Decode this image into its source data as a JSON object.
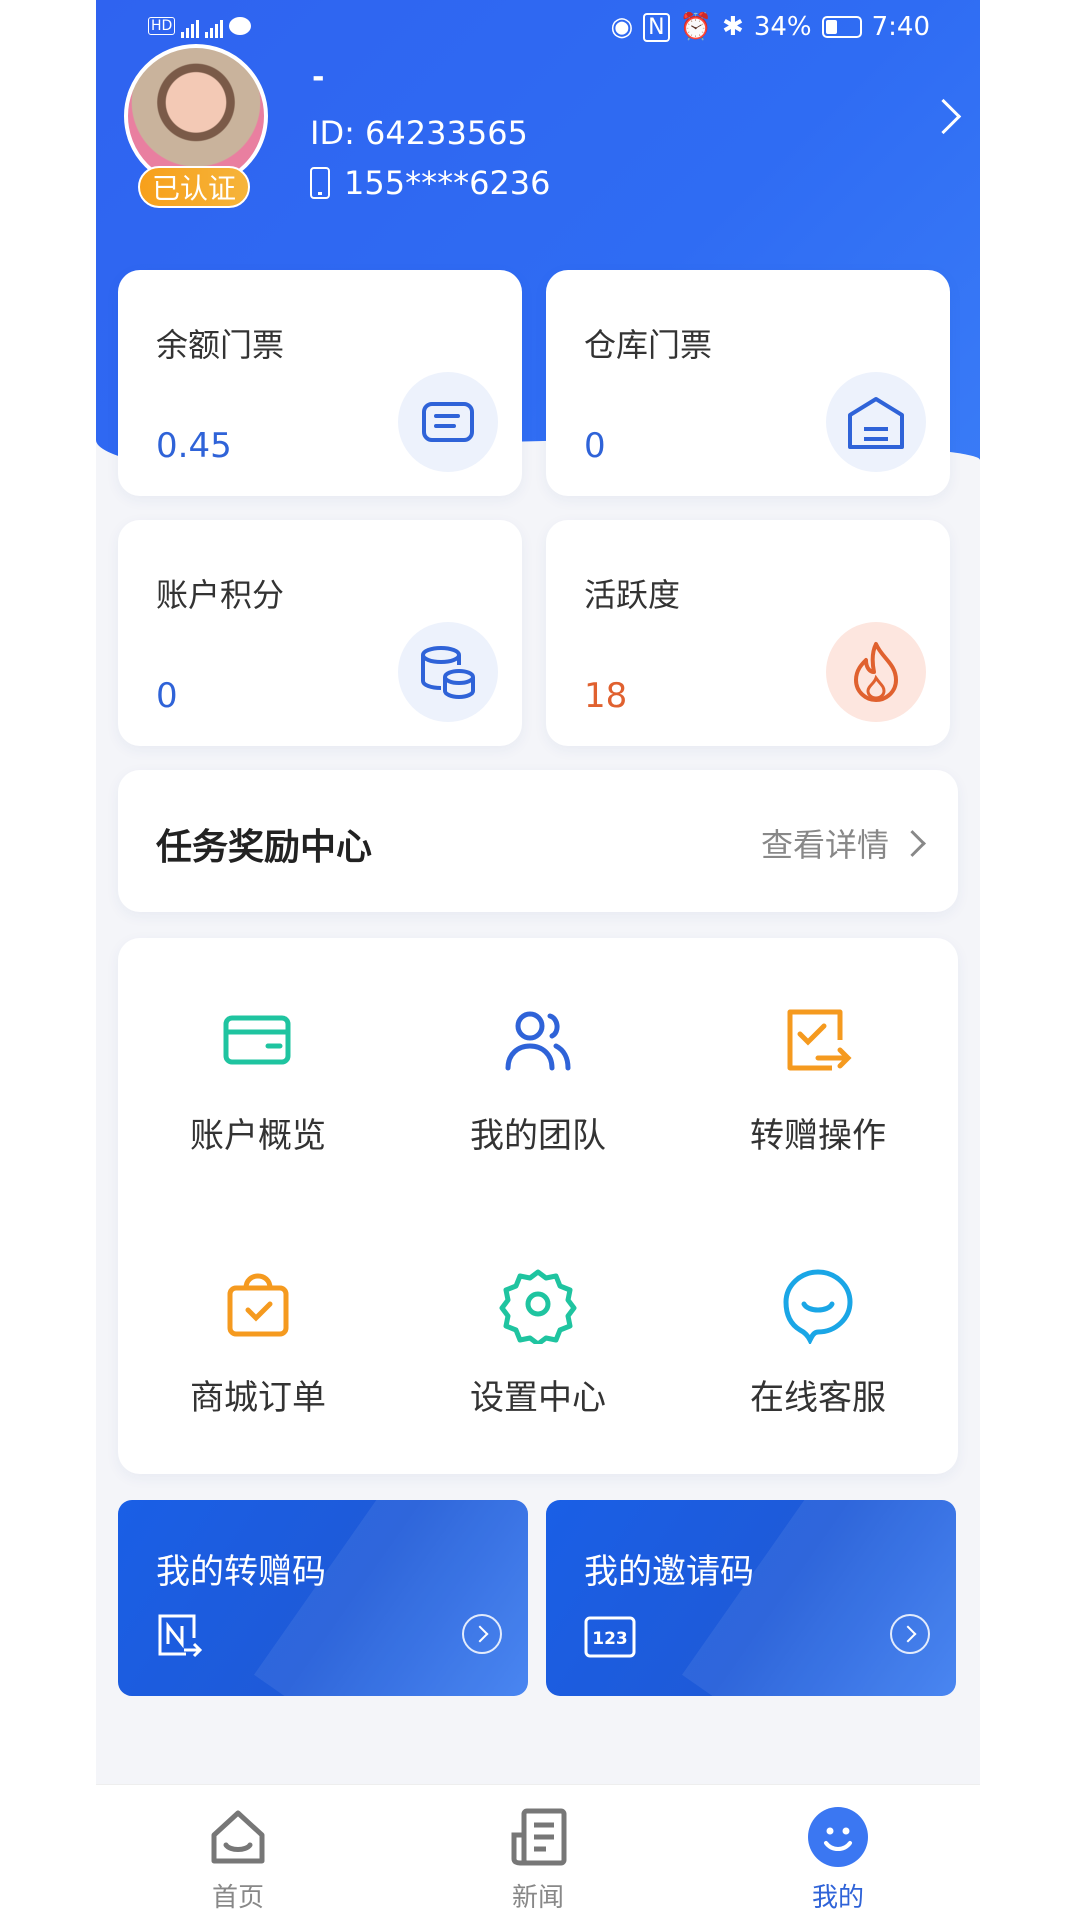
{
  "status_bar": {
    "left_indicators": "HD 1 4G 4G",
    "battery": "34%",
    "battery_level": 0.34,
    "time": "7:40"
  },
  "profile": {
    "nickname": "-",
    "id_text": "ID:  64233565",
    "phone": "155****6236",
    "verified_badge": "已认证"
  },
  "stats": [
    {
      "label": "余额门票",
      "value": "0.45",
      "icon": "ticket-icon"
    },
    {
      "label": "仓库门票",
      "value": "0",
      "icon": "warehouse-icon"
    },
    {
      "label": "账户积分",
      "value": "0",
      "icon": "coins-icon"
    },
    {
      "label": "活跃度",
      "value": "18",
      "icon": "flame-icon"
    }
  ],
  "task_center": {
    "title": "任务奖励中心",
    "more": "查看详情"
  },
  "grid": [
    {
      "label": "账户概览",
      "icon": "card-icon"
    },
    {
      "label": "我的团队",
      "icon": "team-icon"
    },
    {
      "label": "转赠操作",
      "icon": "transfer-icon"
    },
    {
      "label": "商城订单",
      "icon": "shopping-bag-icon"
    },
    {
      "label": "设置中心",
      "icon": "gear-icon"
    },
    {
      "label": "在线客服",
      "icon": "chat-smile-icon"
    }
  ],
  "codes": [
    {
      "title": "我的转赠码",
      "icon": "n-transfer-icon"
    },
    {
      "title": "我的邀请码",
      "icon": "123-icon"
    }
  ],
  "tabs": [
    {
      "label": "首页",
      "icon": "home-icon"
    },
    {
      "label": "新闻",
      "icon": "news-icon"
    },
    {
      "label": "我的",
      "icon": "smile-face-icon",
      "active": true
    }
  ],
  "colors": {
    "primary": "#2f63f0",
    "accent_orange": "#e0612f",
    "verified": "#f7a01b"
  }
}
